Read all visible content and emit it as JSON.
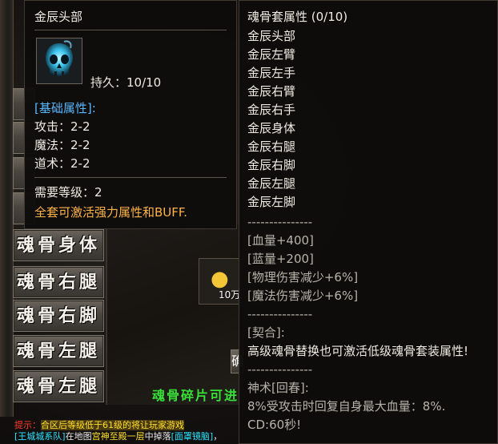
{
  "background": {
    "side_buttons": [
      "魂骨身体",
      "魂骨右腿",
      "魂骨右脚",
      "魂骨左腿",
      "魂骨左腿"
    ],
    "gold_amount": "10万",
    "small_button_label": "确",
    "green_text": "魂骨碎片可进",
    "chat": {
      "line1": {
        "prefix": "提示：",
        "text": "合区后等级低于61级的将让玩家游戏"
      },
      "line2": {
        "tag1": "[王城城系队]",
        "mid": "在地图",
        "loc": "宫神至殿一层",
        "mid2": "中掉落",
        "tag2": "[面罩镜脑]",
        "end": "，"
      }
    }
  },
  "item_tooltip": {
    "name": "金辰头部",
    "icon": "skull-icon",
    "durability": "持久：10/10",
    "base_attr_header": "[基础属性]:",
    "attrs": [
      "攻击：2-2",
      "魔法：2-2",
      "道术：2-2"
    ],
    "required_level": "需要等级：2",
    "set_note": "全套可激活强力属性和BUFF."
  },
  "set_tooltip": {
    "title": "魂骨套属性 (0/10)",
    "pieces": [
      "金辰头部",
      "金辰左臂",
      "金辰左手",
      "金辰右臂",
      "金辰右手",
      "金辰身体",
      "金辰右腿",
      "金辰右脚",
      "金辰左腿",
      "金辰左脚"
    ],
    "separator": "---------------",
    "bonuses": [
      "[血量+400]",
      "[蓝量+200]",
      "[物理伤害减少+6%]",
      "[魔法伤害减少+6%]"
    ],
    "contract_header": "[契合]:",
    "contract_text": "高级魂骨替换也可激活低级魂骨套装属性!",
    "divine_header": "神术[回春]:",
    "divine_text": "8%受攻击时回复自身最大血量：8%.",
    "cooldown": "CD:60秒!"
  },
  "colors": {
    "attr_blue": "#5ab8ff",
    "set_note_orange": "#ffb347",
    "chat_green": "#38e038"
  }
}
